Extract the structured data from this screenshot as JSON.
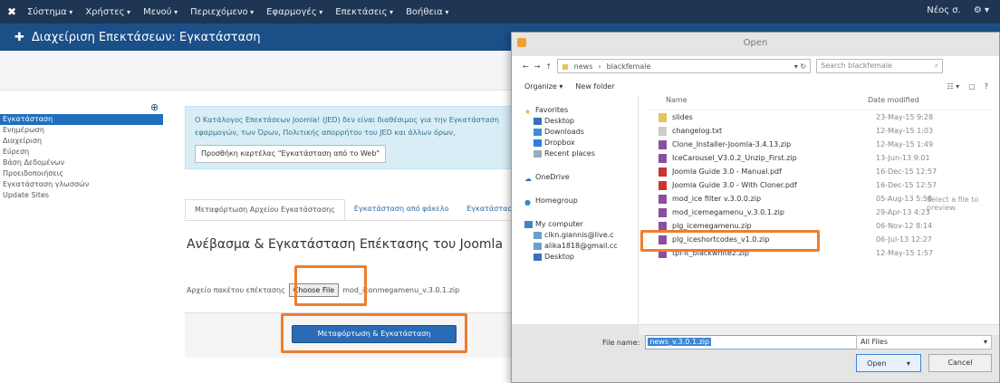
{
  "topbar": {
    "menu": [
      "Σύστημα",
      "Χρήστες",
      "Μενού",
      "Περιεχόμενο",
      "Εφαρμογές",
      "Επεκτάσεις",
      "Βοήθεια"
    ],
    "right_label": "Νέος σ.",
    "settings_icon": "gear-icon"
  },
  "header": {
    "title": "Διαχείριση Επεκτάσεων: Εγκατάσταση"
  },
  "sidebar": {
    "items": [
      "Εγκατάσταση",
      "Ενημέρωση",
      "Διαχείριση",
      "Εύρεση",
      "Βάση Δεδομένων",
      "Προειδοποιήσεις",
      "Εγκατάσταση γλωσσών",
      "Update Sites"
    ]
  },
  "alert": {
    "line1": "Ο Κατάλογος Επεκτάσεων Joomla! (JED) δεν είναι διαθέσιμος για την Εγκατάσταση",
    "line2": "εφαρμογών, των Όρων, Πολιτικής απορρήτου του JED και άλλων όρων,",
    "button": "Προσθήκη καρτέλας \"Εγκατάσταση από το Web\""
  },
  "tabs": [
    "Μεταφόρτωση Αρχείου Εγκατάστασης",
    "Εγκατάσταση από φάκελο",
    "Εγκατάσταση από URL"
  ],
  "package": {
    "title": "Ανέβασμα & Εγκατάσταση Επέκτασης του Joomla",
    "file_label": "Αρχείο πακέτου επέκτασης",
    "choose_button": "Choose File",
    "chosen_file": "mod_iconmegamenu_v.3.0.1.zip",
    "install_button": "Μεταφόρτωση & Εγκατάσταση"
  },
  "dialog": {
    "title": "Open",
    "address": [
      "news",
      "blackfemale"
    ],
    "search_placeholder": "Search blackfemale",
    "organize": "Organize ▾",
    "new_folder": "New folder",
    "col_name": "Name",
    "col_date": "Date modified",
    "nav": {
      "favorites": "Favorites",
      "favorites_items": [
        "Desktop",
        "Downloads",
        "Dropbox",
        "Recent places"
      ],
      "onedrive": "OneDrive",
      "homegroup": "Homegroup",
      "computer": "My computer",
      "computer_items": [
        "clkn.giannis@live.c",
        "alika1818@gmail.cc",
        "Desktop"
      ]
    },
    "files": [
      {
        "name": "slides",
        "date": "23-May-15 9:28",
        "color": "#e8c25a"
      },
      {
        "name": "changelog.txt",
        "date": "12-May-15 1:03",
        "color": "#cccccc"
      },
      {
        "name": "Clone_Installer-Joomla-3.4.13.zip",
        "date": "12-May-15 1:49",
        "color": "#8a4f9e"
      },
      {
        "name": "IceCarousel_V3.0.2_Unzip_First.zip",
        "date": "13-Jun-13 9:01",
        "color": "#8a4f9e"
      },
      {
        "name": "Joomla Guide 3.0 - Manual.pdf",
        "date": "16-Dec-15 12:57",
        "color": "#c33"
      },
      {
        "name": "Joomla Guide 3.0 - With Cloner.pdf",
        "date": "16-Dec-15 12:57",
        "color": "#c33"
      },
      {
        "name": "mod_ice filter v.3.0.0.zip",
        "date": "05-Aug-13 5:58",
        "color": "#8a4f9e"
      },
      {
        "name": "mod_icemegamenu_v.3.0.1.zip",
        "date": "29-Apr-13 4:23",
        "color": "#8a4f9e"
      },
      {
        "name": "plg_icemegamenu.zip",
        "date": "06-Nov-12 8:14",
        "color": "#8a4f9e"
      },
      {
        "name": "plg_iceshortcodes_v1.0.zip",
        "date": "06-Jul-13 12:27",
        "color": "#8a4f9e"
      },
      {
        "name": "tpl-it_blackwhite2.zip",
        "date": "12-May-15 1:57",
        "color": "#8a4f9e"
      }
    ],
    "preview_text": "Select a file to preview.",
    "filename_label": "File name:",
    "filename_value": "news_v.3.0.1.zip",
    "filter_value": "All Files",
    "open_button": "Open",
    "cancel_button": "Cancel"
  }
}
